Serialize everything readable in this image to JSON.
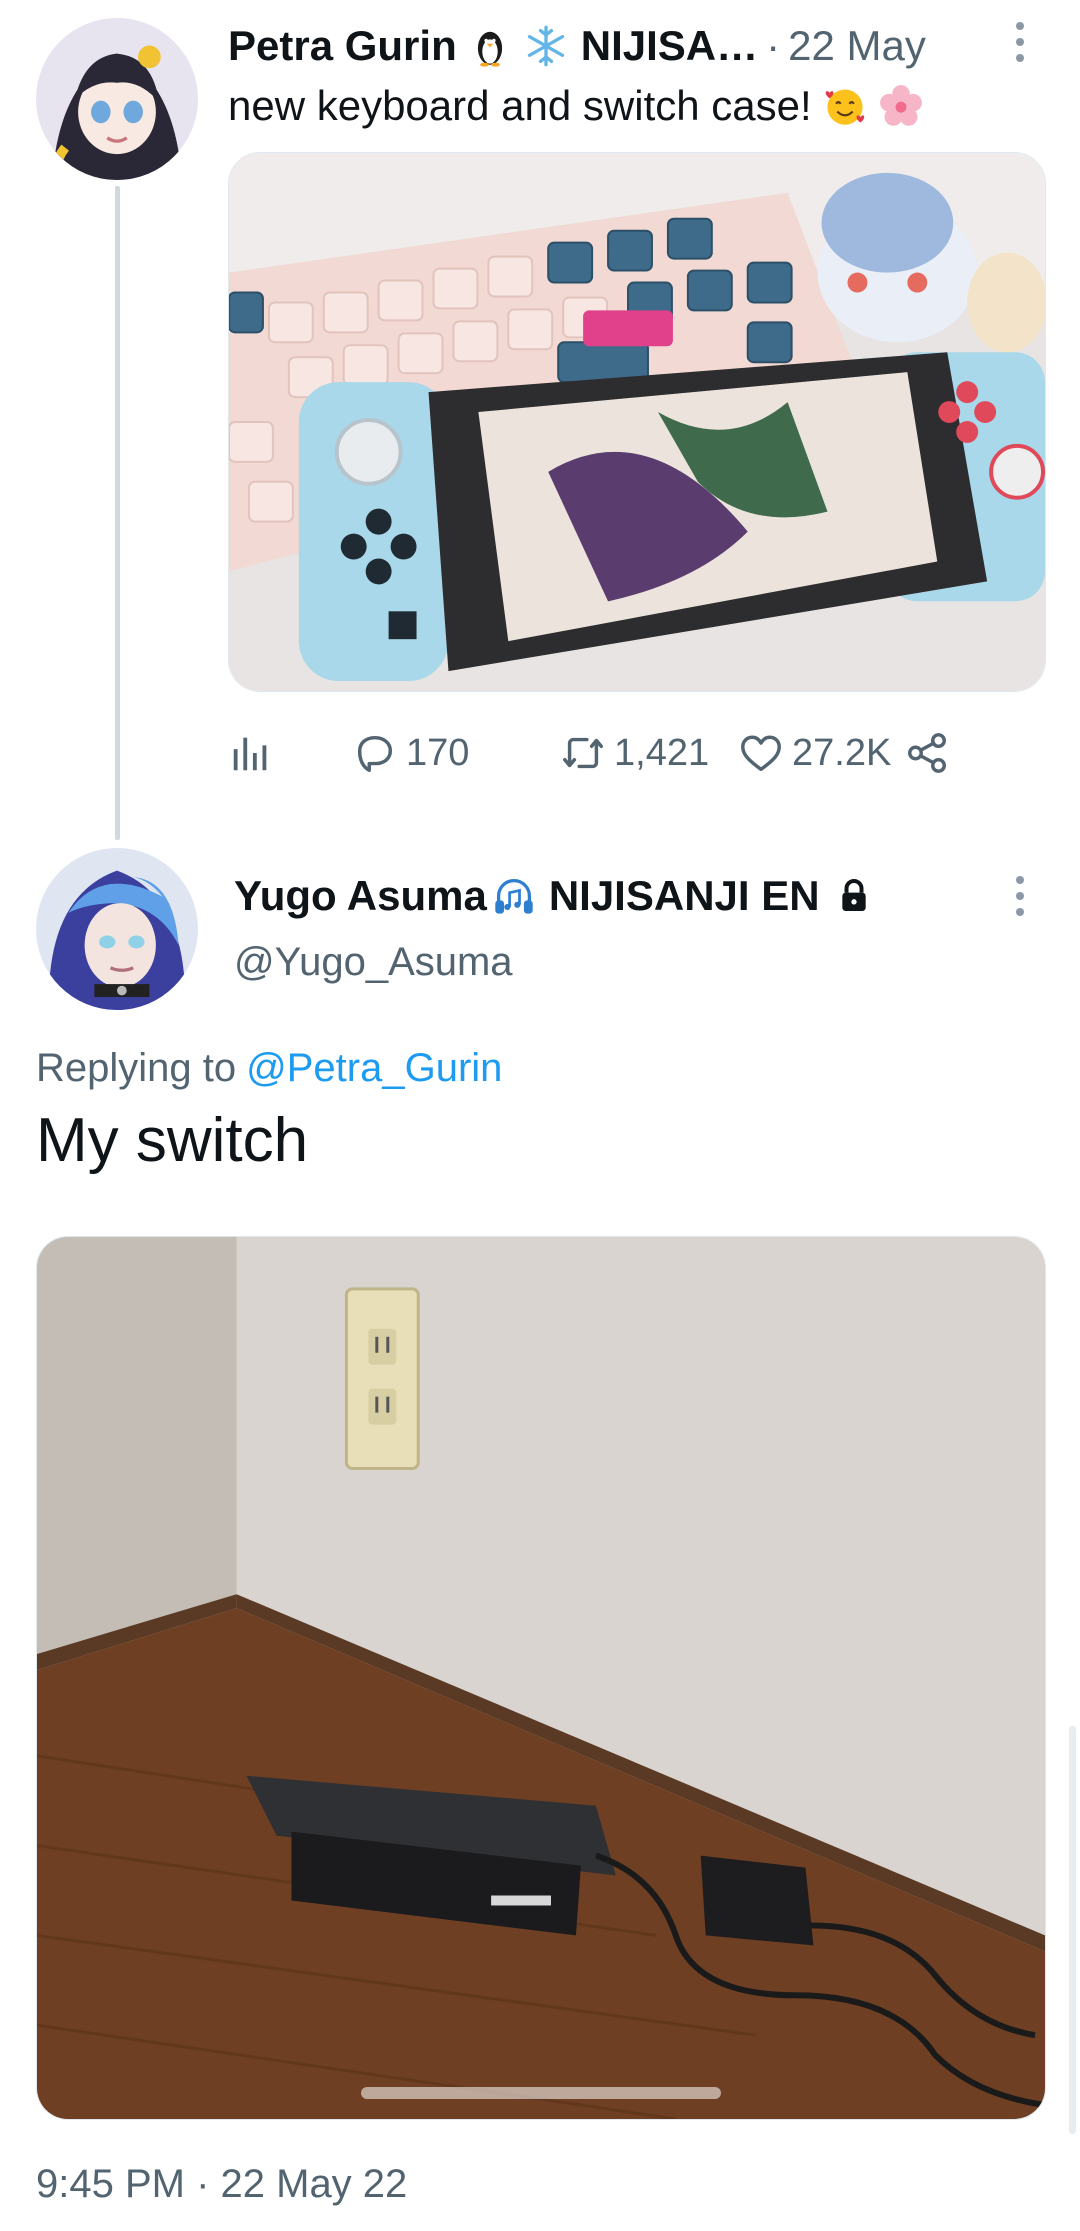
{
  "parent_tweet": {
    "author_name": "Petra Gurin",
    "affiliation": "NIJISA…",
    "separator": "·",
    "time": "22 May",
    "text": "new keyboard and switch case!",
    "name_emojis": [
      "penguin-icon",
      "snowflake-icon"
    ],
    "text_emojis": [
      "smiling-face-with-hearts-icon",
      "cherry-blossom-icon"
    ],
    "stats": {
      "replies": "170",
      "retweets": "1,421",
      "likes": "27.2K"
    }
  },
  "reply_tweet": {
    "author_name": "Yugo Asuma",
    "affiliation": "NIJISANJI EN",
    "handle": "@Yugo_Asuma",
    "replying_prefix": "Replying to",
    "replying_to": "@Petra_Gurin",
    "text": "My switch",
    "timestamp": "9:45 PM · 22 May 22",
    "name_emoji": "headphone-music-icon",
    "protected_icon": "lock-icon"
  },
  "colors": {
    "primary_text": "#0f1419",
    "secondary_text": "#536471",
    "link": "#1d9bf0",
    "thread_line": "#cfd9de"
  }
}
